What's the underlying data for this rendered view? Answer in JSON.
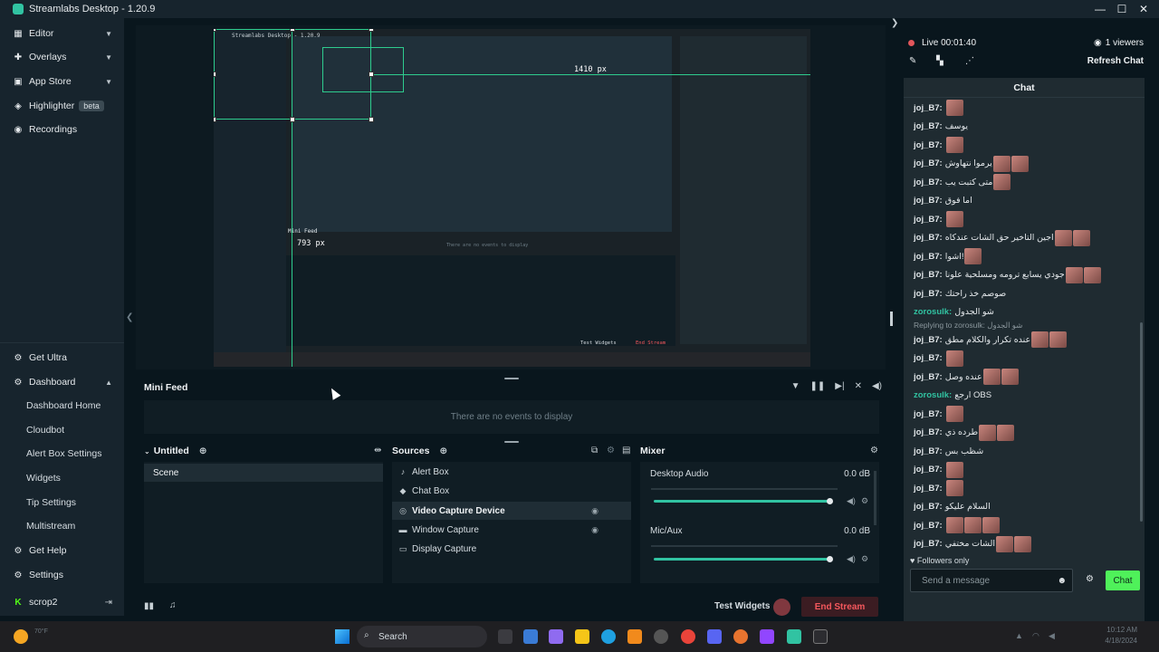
{
  "window": {
    "title": "Streamlabs Desktop - 1.20.9",
    "controls": [
      "—",
      "☐",
      "✕"
    ]
  },
  "sidebar": {
    "top_items": [
      {
        "label": "Editor",
        "icon": "editor-icon"
      },
      {
        "label": "Overlays",
        "icon": "overlays-icon"
      },
      {
        "label": "App Store",
        "icon": "app-store-icon"
      },
      {
        "label": "Highlighter",
        "icon": "highlighter-icon",
        "badge": "beta"
      },
      {
        "label": "Recordings",
        "icon": "recordings-icon"
      }
    ],
    "get_ultra": "Get Ultra",
    "dashboard": "Dashboard",
    "dashboard_items": [
      "Dashboard Home",
      "Cloudbot",
      "Alert Box Settings",
      "Widgets",
      "Tip Settings",
      "Multistream"
    ],
    "get_help": "Get Help",
    "settings": "Settings",
    "user": "scrop2"
  },
  "preview": {
    "measure_width": "1410 px",
    "measure_height": "793 px",
    "inner_title": "Streamlabs Desktop - 1.20.9",
    "inner_mini_feed": "Mini Feed",
    "inner_no_events": "There are no events to display",
    "inner_test_widgets": "Test Widgets",
    "inner_end_stream": "End Stream"
  },
  "minifeed": {
    "title": "Mini Feed",
    "empty": "There are no events to display"
  },
  "scenes": {
    "title": "Untitled",
    "items": [
      "Scene"
    ]
  },
  "sources": {
    "title": "Sources",
    "items": [
      {
        "label": "Alert Box",
        "icon": "bell-icon"
      },
      {
        "label": "Chat Box",
        "icon": "chat-icon"
      },
      {
        "label": "Video Capture Device",
        "icon": "webcam-icon",
        "selected": true
      },
      {
        "label": "Window Capture",
        "icon": "window-icon"
      },
      {
        "label": "Display Capture",
        "icon": "monitor-icon"
      }
    ]
  },
  "mixer": {
    "title": "Mixer",
    "channels": [
      {
        "name": "Desktop Audio",
        "level": "0.0 dB"
      },
      {
        "name": "Mic/Aux",
        "level": "0.0 dB"
      }
    ]
  },
  "bottom": {
    "test_widgets": "Test Widgets",
    "end_stream": "End Stream"
  },
  "chat": {
    "live": "Live 00:01:40",
    "viewers": "1 viewers",
    "refresh": "Refresh Chat",
    "title": "Chat",
    "messages": [
      {
        "user": "joj_B7:",
        "text": "",
        "emotes": 1
      },
      {
        "user": "joj_B7:",
        "text": "يوسف",
        "emotes": 0
      },
      {
        "user": "joj_B7:",
        "text": "",
        "emotes": 1
      },
      {
        "user": "joj_B7:",
        "text": "يرموا نتهاوش",
        "emotes": 2
      },
      {
        "user": "joj_B7:",
        "text": "متى كتبت يب",
        "emotes": 1
      },
      {
        "user": "joj_B7:",
        "text": "اما فوق",
        "emotes": 0
      },
      {
        "user": "joj_B7:",
        "text": "",
        "emotes": 1
      },
      {
        "user": "joj_B7:",
        "text": "اجين التاخير حق الشات عندكاه",
        "emotes": 2
      },
      {
        "user": "joj_B7:",
        "text": "اشوا!",
        "emotes": 1
      },
      {
        "user": "joj_B7:",
        "text": "جودي يسابع ترومه ومسلحية علونا",
        "emotes": 2
      },
      {
        "user": "joj_B7:",
        "text": "صوصم خذ راحتك",
        "emotes": 0
      },
      {
        "user": "zorosulk:",
        "text": "شو الجدول",
        "emotes": 0,
        "green": true
      },
      {
        "user": "joj_B7:",
        "text": "عنده تكرار والكلام مطق",
        "emotes": 2,
        "reply": "Replying to zorosulk: شو الجدول"
      },
      {
        "user": "joj_B7:",
        "text": "",
        "emotes": 1
      },
      {
        "user": "joj_B7:",
        "text": "عنده وصل",
        "emotes": 2
      },
      {
        "user": "zorosulk:",
        "text": "ارجع OBS",
        "emotes": 0,
        "green": true
      },
      {
        "user": "joj_B7:",
        "text": "",
        "emotes": 1
      },
      {
        "user": "joj_B7:",
        "text": "طرده ذي",
        "emotes": 2
      },
      {
        "user": "joj_B7:",
        "text": "شظب بس",
        "emotes": 0
      },
      {
        "user": "joj_B7:",
        "text": "",
        "emotes": 1
      },
      {
        "user": "joj_B7:",
        "text": "",
        "emotes": 1
      },
      {
        "user": "joj_B7:",
        "text": "السلام عليكو",
        "emotes": 0
      },
      {
        "user": "joj_B7:",
        "text": "",
        "emotes": 3
      },
      {
        "user": "joj_B7:",
        "text": "الشات مختفي",
        "emotes": 2
      }
    ],
    "followers_only": "♥ Followers only",
    "input_placeholder": "Send a message",
    "send_label": "Chat"
  },
  "taskbar": {
    "search_placeholder": "Search",
    "weather": "70°F",
    "time": "10:12 AM",
    "date": "4/18/2024"
  },
  "colors": {
    "accent": "#31c3a2",
    "end_stream": "#f5585d",
    "send_button": "#4ff15a"
  }
}
